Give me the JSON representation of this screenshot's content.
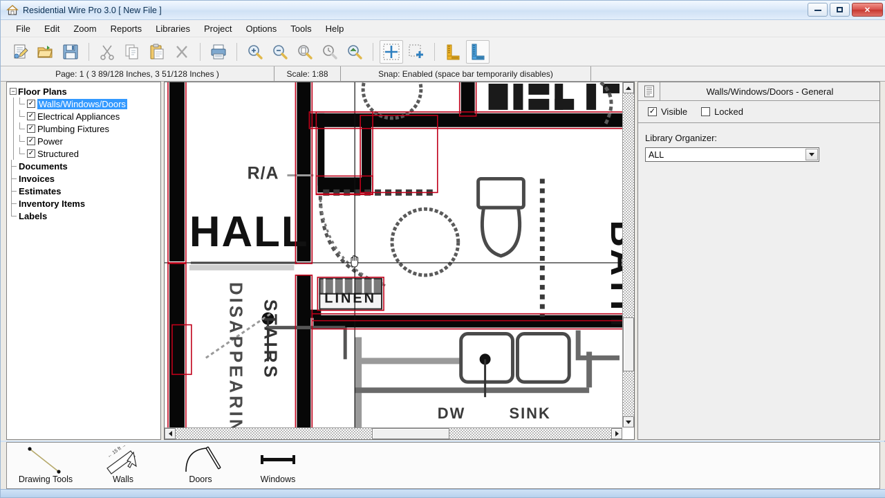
{
  "window": {
    "title": "Residential Wire Pro 3.0 [ New File ]",
    "app_icon": "house-icon",
    "minimize_label": "Minimize",
    "maximize_label": "Maximize",
    "close_label": "Close"
  },
  "menubar": {
    "items": [
      {
        "label": "File"
      },
      {
        "label": "Edit"
      },
      {
        "label": "Zoom"
      },
      {
        "label": "Reports"
      },
      {
        "label": "Libraries"
      },
      {
        "label": "Project"
      },
      {
        "label": "Options"
      },
      {
        "label": "Tools"
      },
      {
        "label": "Help"
      }
    ]
  },
  "toolbar": {
    "buttons": [
      {
        "name": "new-file-icon",
        "tip": "New"
      },
      {
        "name": "open-folder-icon",
        "tip": "Open"
      },
      {
        "name": "save-disk-icon",
        "tip": "Save"
      },
      {
        "name": "cut-scissors-icon",
        "tip": "Cut"
      },
      {
        "name": "copy-icon",
        "tip": "Copy"
      },
      {
        "name": "paste-clipboard-icon",
        "tip": "Paste"
      },
      {
        "name": "delete-x-icon",
        "tip": "Delete"
      },
      {
        "name": "print-icon",
        "tip": "Print"
      },
      {
        "name": "zoom-in-icon",
        "tip": "Zoom In"
      },
      {
        "name": "zoom-out-icon",
        "tip": "Zoom Out"
      },
      {
        "name": "zoom-page-icon",
        "tip": "Zoom Page"
      },
      {
        "name": "zoom-previous-icon",
        "tip": "Zoom Previous"
      },
      {
        "name": "zoom-selection-icon",
        "tip": "Zoom Selection"
      },
      {
        "name": "select-crosshair-icon",
        "tip": "Select"
      },
      {
        "name": "add-selection-icon",
        "tip": "Add to Selection"
      },
      {
        "name": "measure-ruler-yellow-icon",
        "tip": "Measure"
      },
      {
        "name": "measure-ruler-blue-icon",
        "tip": "Calibrate Scale"
      }
    ]
  },
  "infobar": {
    "page": "Page: 1   ( 3 89/128 Inches, 3 51/128 Inches )",
    "scale": "Scale: 1:88",
    "snap": "Snap: Enabled   (space bar temporarily disables)"
  },
  "tree": {
    "root": {
      "label": "Floor Plans",
      "expander": "−"
    },
    "children": [
      {
        "label": "Walls/Windows/Doors",
        "checked": true,
        "selected": true
      },
      {
        "label": "Electrical Appliances",
        "checked": true,
        "selected": false
      },
      {
        "label": "Plumbing Fixtures",
        "checked": true,
        "selected": false
      },
      {
        "label": "Power",
        "checked": true,
        "selected": false
      },
      {
        "label": "Structured",
        "checked": true,
        "selected": false
      }
    ],
    "siblings": [
      {
        "label": "Documents"
      },
      {
        "label": "Invoices"
      },
      {
        "label": "Estimates"
      },
      {
        "label": "Inventory Items"
      },
      {
        "label": "Labels"
      }
    ]
  },
  "properties": {
    "header_icon": "list-properties-icon",
    "title": "Walls/Windows/Doors - General",
    "visible": {
      "label": "Visible",
      "checked": true
    },
    "locked": {
      "label": "Locked",
      "checked": false
    },
    "library_organizer_label": "Library Organizer:",
    "library_organizer_value": "ALL",
    "library_organizer_options": [
      "ALL"
    ]
  },
  "canvas": {
    "cursor": "open-hand-cursor",
    "selection_color": "#c0001a",
    "room_labels": [
      {
        "text": "HALL"
      },
      {
        "text": "BATH"
      },
      {
        "text": "LINEN"
      },
      {
        "text": "OPEN"
      },
      {
        "text": "R/A"
      },
      {
        "text": "DISAPPEARING"
      },
      {
        "text": "STAIRS"
      },
      {
        "text": "DW"
      },
      {
        "text": "SINK"
      }
    ]
  },
  "scrollbars": {
    "vertical": {
      "up_arrow": "scroll-up-arrow-icon",
      "down_arrow": "scroll-down-arrow-icon"
    },
    "horizontal": {
      "left_arrow": "scroll-left-arrow-icon",
      "right_arrow": "scroll-right-arrow-icon"
    }
  },
  "palette": {
    "items": [
      {
        "label": "Drawing Tools",
        "icon": "line-segment-icon"
      },
      {
        "label": "Walls",
        "icon": "wall-measure-icon"
      },
      {
        "label": "Doors",
        "icon": "door-swing-icon"
      },
      {
        "label": "Windows",
        "icon": "window-symbol-icon"
      }
    ]
  }
}
